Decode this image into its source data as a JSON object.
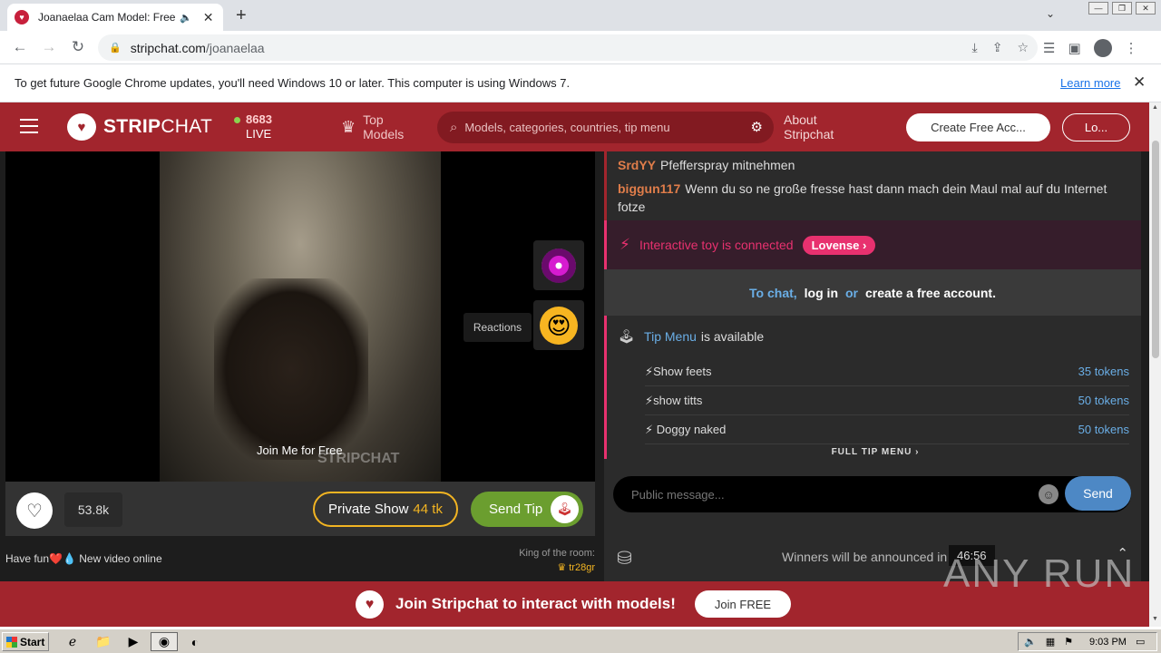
{
  "browser": {
    "tab_title": "Joanaelaa Cam Model: Free Live",
    "url_domain": "stripchat.com",
    "url_path": "/joanaelaa"
  },
  "infobar": {
    "message": "To get future Google Chrome updates, you'll need Windows 10 or later. This computer is using Windows 7.",
    "learn_more": "Learn more"
  },
  "header": {
    "brand_bold": "STRIP",
    "brand_light": "CHAT",
    "live_count": "8683",
    "live_label": "LIVE",
    "top_models_line1": "Top",
    "top_models_line2": "Models",
    "search_placeholder": "Models, categories, countries, tip menu",
    "about_line1": "About",
    "about_line2": "Stripchat",
    "create_account": "Create Free Acc...",
    "login": "Lo..."
  },
  "video": {
    "promo_text": "Join Me for Free",
    "watermark": "STRIPCHAT",
    "reactions_label": "Reactions"
  },
  "controls": {
    "favorites_count": "53.8k",
    "private_show_label": "Private Show",
    "private_show_price": "44 tk",
    "send_tip_label": "Send Tip"
  },
  "room": {
    "topic": "Have fun❤️💧 New video online",
    "king_label": "King of the room:",
    "king_user": "tr28gr"
  },
  "chat": {
    "messages": [
      {
        "user": "SrdYY",
        "text": "Pfefferspray mitnehmen"
      },
      {
        "user": "biggun117",
        "text": "Wenn du so ne große fresse hast dann mach dein Maul mal auf du Internet fotze"
      }
    ],
    "toy_text": "Interactive toy is connected",
    "toy_brand": "Lovense",
    "login_prompt": {
      "to_chat": "To chat,",
      "log_in": "log in",
      "or": "or",
      "create": "create a free account."
    },
    "tip_menu": {
      "link": "Tip Menu",
      "suffix": "is available",
      "items": [
        {
          "name": "Show feets",
          "price": "35 tokens"
        },
        {
          "name": "show titts",
          "price": "50 tokens"
        },
        {
          "name": " Doggy naked",
          "price": "50 tokens"
        }
      ],
      "full_menu": "FULL TIP MENU"
    },
    "composer_placeholder": "Public message...",
    "send": "Send"
  },
  "winners": {
    "text": "Winners will be announced in",
    "timer": "46:56"
  },
  "join_bar": {
    "text": "Join Stripchat to interact with models!",
    "button": "Join FREE"
  },
  "watermark_anyrun": "ANY RUN",
  "taskbar": {
    "start": "Start",
    "clock": "9:03 PM"
  },
  "colors": {
    "brand_red": "#a2252d",
    "accent_pink": "#e8316f",
    "link_blue": "#6aaee6",
    "tip_green": "#6b9e2f",
    "gold": "#f2b422"
  }
}
